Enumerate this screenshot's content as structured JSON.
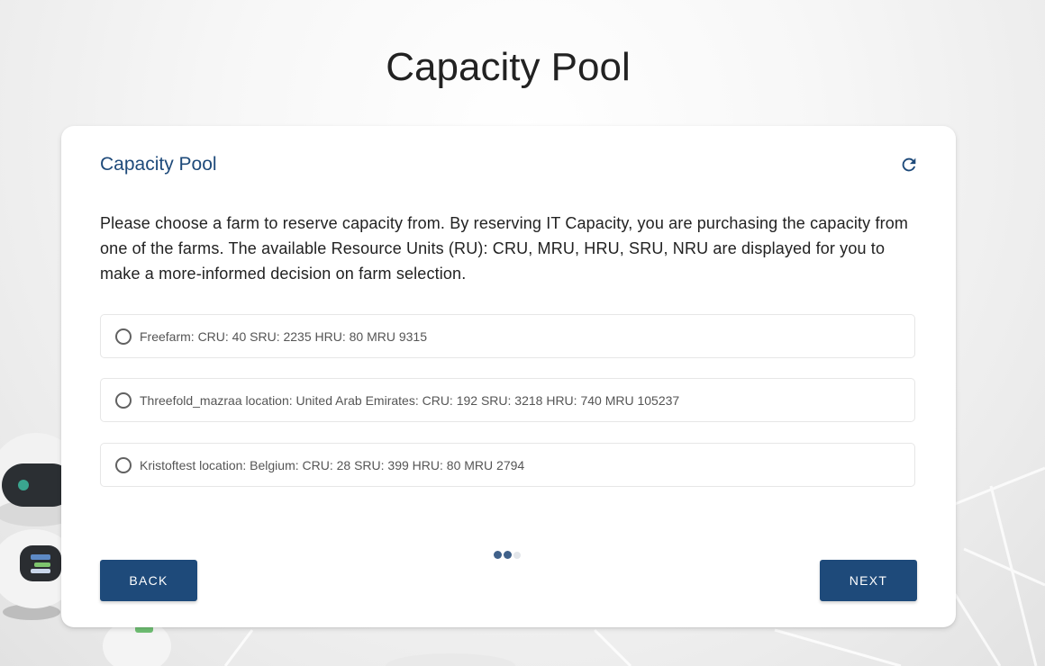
{
  "page": {
    "title": "Capacity Pool"
  },
  "card": {
    "title": "Capacity Pool",
    "refresh_icon": "refresh-icon",
    "description": "Please choose a farm to reserve capacity from. By reserving IT Capacity, you are purchasing the capacity from one of the farms. The available Resource Units (RU): CRU, MRU, HRU, SRU, NRU are displayed for you to make a more-informed decision on farm selection."
  },
  "farms": [
    {
      "label": "Freefarm: CRU: 40 SRU: 2235 HRU: 80 MRU 9315",
      "selected": false
    },
    {
      "label": "Threefold_mazraa location: United Arab Emirates: CRU: 192 SRU: 3218 HRU: 740 MRU 105237",
      "selected": false
    },
    {
      "label": "Kristoftest location: Belgium: CRU: 28 SRU: 399 HRU: 80 MRU 2794",
      "selected": false
    }
  ],
  "stepper": {
    "total_steps": 3,
    "current_step": 2
  },
  "actions": {
    "back_label": "BACK",
    "next_label": "NEXT"
  },
  "colors": {
    "accent": "#1e4a7a",
    "title_text": "#222222",
    "option_border": "#e6e6e6"
  }
}
